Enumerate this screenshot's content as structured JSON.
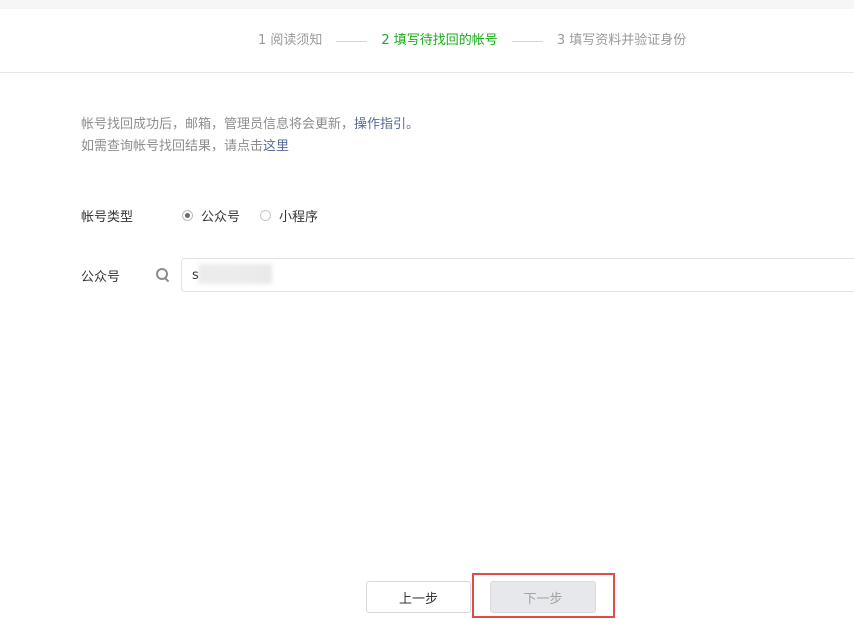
{
  "steps": [
    {
      "label": "1 阅读须知"
    },
    {
      "label": "2 填写待找回的帐号"
    },
    {
      "label": "3 填写资料并验证身份"
    }
  ],
  "notice": {
    "line1_text": "帐号找回成功后，邮箱，管理员信息将会更新，",
    "line1_link": "操作指引。",
    "line2_text": "如需查询帐号找回结果，请点击",
    "line2_link": "这里"
  },
  "form": {
    "account_type_label": "帐号类型",
    "options": [
      {
        "label": "公众号",
        "checked": true
      },
      {
        "label": "小程序",
        "checked": false
      }
    ],
    "account_label": "公众号",
    "account_value": "s"
  },
  "buttons": {
    "prev_label": "上一步",
    "next_label": "下一步"
  },
  "colors": {
    "active_step": "#1aad19",
    "link": "#576b95",
    "highlight": "#e34a4a"
  }
}
